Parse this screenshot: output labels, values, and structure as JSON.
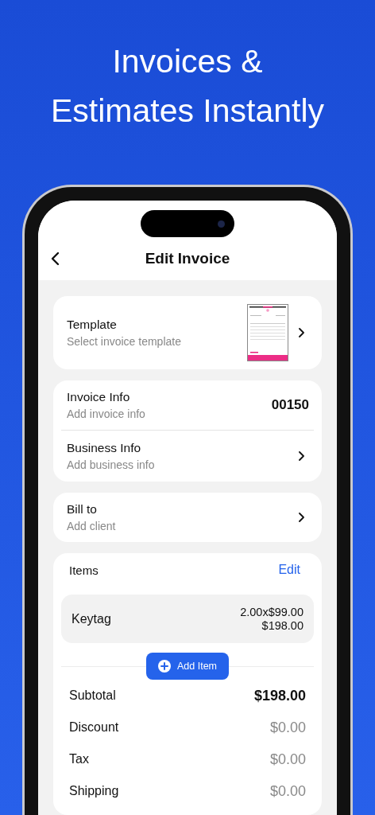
{
  "headline_lines": [
    "Invoices &",
    "Estimates Instantly"
  ],
  "nav": {
    "title": "Edit Invoice"
  },
  "template_card": {
    "title": "Template",
    "subtitle": "Select invoice template"
  },
  "info_cards": [
    {
      "rows": [
        {
          "kind": "value",
          "title": "Invoice Info",
          "subtitle": "Add invoice info",
          "value": "00150"
        },
        {
          "kind": "chevron",
          "title": "Business Info",
          "subtitle": "Add business info"
        }
      ]
    },
    {
      "rows": [
        {
          "kind": "chevron",
          "title": "Bill to",
          "subtitle": "Add client"
        }
      ]
    }
  ],
  "items": {
    "title": "Items",
    "edit_label": "Edit",
    "list": [
      {
        "name": "Keytag",
        "quantity_price": "2.00x$99.00",
        "total": "$198.00"
      }
    ],
    "add_label": "Add Item"
  },
  "totals": [
    {
      "label": "Subtotal",
      "value": "$198.00",
      "bold": true
    },
    {
      "label": "Discount",
      "value": "$0.00",
      "bold": false
    },
    {
      "label": "Tax",
      "value": "$0.00",
      "bold": false
    },
    {
      "label": "Shipping",
      "value": "$0.00",
      "bold": false
    }
  ]
}
